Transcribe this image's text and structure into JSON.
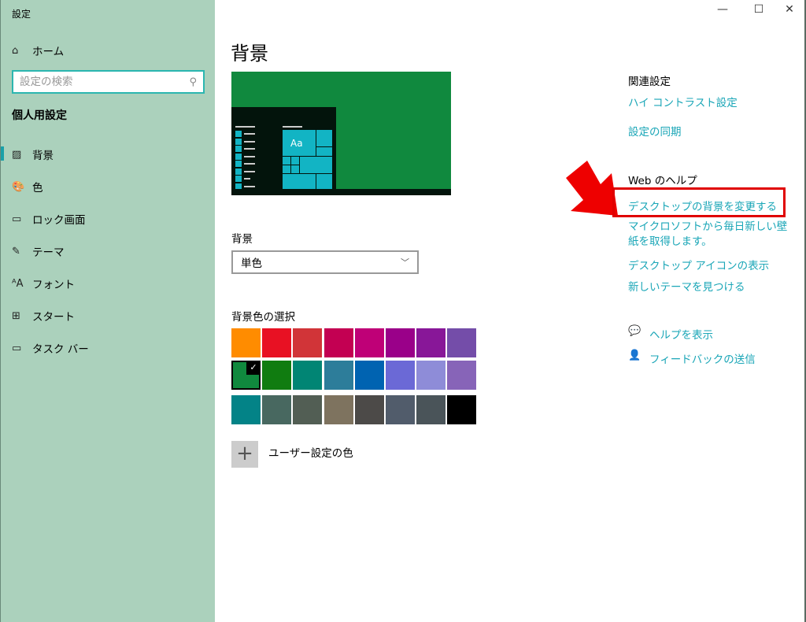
{
  "window": {
    "title": "設定",
    "minimize": "—",
    "maximize": "☐",
    "close": "✕"
  },
  "sidebar": {
    "home": "ホーム",
    "search_placeholder": "設定の検索",
    "section": "個人用設定",
    "items": [
      {
        "label": "背景",
        "icon": "picture-icon",
        "glyph": "▨"
      },
      {
        "label": "色",
        "icon": "palette-icon",
        "glyph": "🎨"
      },
      {
        "label": "ロック画面",
        "icon": "lock-screen-icon",
        "glyph": "▭"
      },
      {
        "label": "テーマ",
        "icon": "theme-icon",
        "glyph": "✎"
      },
      {
        "label": "フォント",
        "icon": "font-icon",
        "glyph": "ᴬA"
      },
      {
        "label": "スタート",
        "icon": "start-icon",
        "glyph": "⊞"
      },
      {
        "label": "タスク バー",
        "icon": "taskbar-icon",
        "glyph": "▭"
      }
    ]
  },
  "main": {
    "title": "背景",
    "preview_sample": "Aa",
    "background_label": "背景",
    "background_value": "単色",
    "color_label": "背景色の選択",
    "custom_color": "ユーザー設定の色",
    "selected_color": "#10893E",
    "colors": [
      [
        "#FF8C00",
        "#E81123",
        "#D13438",
        "#C30052",
        "#BF0077",
        "#9A0089",
        "#881798",
        "#744DA9"
      ],
      [
        "#10893E",
        "#107C10",
        "#018574",
        "#2D7D9A",
        "#0063B1",
        "#6B69D6",
        "#8E8CD8",
        "#8764B8"
      ],
      [
        "#038387",
        "#486860",
        "#525E54",
        "#7E735F",
        "#4C4A48",
        "#515C6B",
        "#4A5459",
        "#000000"
      ]
    ]
  },
  "related": {
    "title": "関連設定",
    "links": [
      "ハイ コントラスト設定",
      "設定の同期"
    ]
  },
  "web_help": {
    "title": "Web のヘルプ",
    "highlighted": "デスクトップの背景を変更する",
    "links": [
      "マイクロソフトから毎日新しい壁紙を取得します。",
      "デスクトップ アイコンの表示",
      "新しいテーマを見つける"
    ]
  },
  "support": {
    "help": "ヘルプを表示",
    "feedback": "フィードバックの送信"
  },
  "accent": "#1AA6B7"
}
